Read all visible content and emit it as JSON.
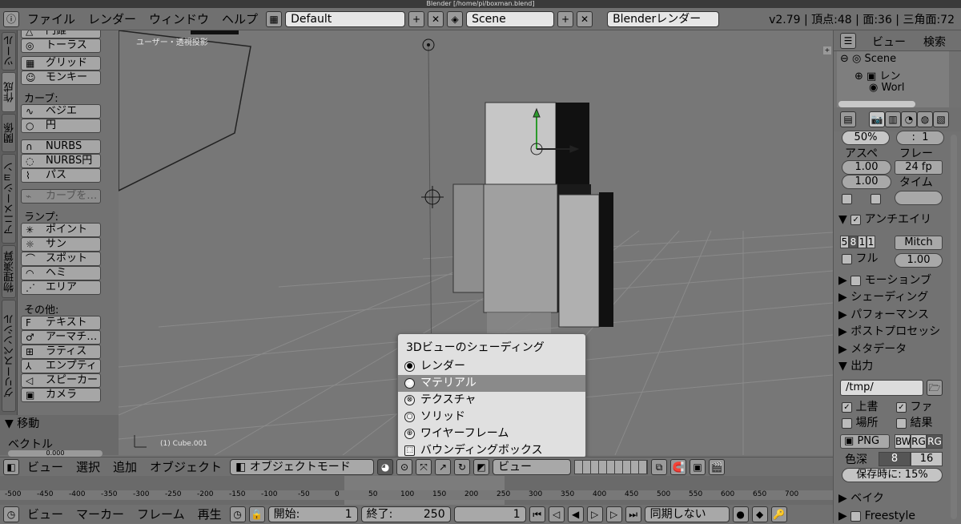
{
  "window_title": "Blender [/home/pi/boxman.blend]",
  "topbar": {
    "menus": [
      "ファイル",
      "レンダー",
      "ウィンドウ",
      "ヘルプ"
    ],
    "layout": "Default",
    "scene": "Scene",
    "engine": "Blenderレンダー",
    "stats": "v2.79 | 頂点:48 | 面:36 | 三角面:72"
  },
  "left_tabs": [
    "ツール",
    "作成",
    "関係",
    "アニメーション",
    "物理演算",
    "グリースペンシル"
  ],
  "tools": {
    "items_top": [
      "円錐",
      "トーラス",
      "グリッド",
      "モンキー"
    ],
    "curve_header": "カーブ:",
    "curve_items": [
      "ベジエ",
      "円",
      "NURBSカ…",
      "NURBS円",
      "パス",
      "カーブを…"
    ],
    "lamp_header": "ランプ:",
    "lamp_items": [
      "ポイント",
      "サン",
      "スポット",
      "ヘミ",
      "エリア"
    ],
    "other_header": "その他:",
    "other_items": [
      "テキスト",
      "アーマチ…",
      "ラティス",
      "エンプティ",
      "スピーカー",
      "カメラ"
    ]
  },
  "operator": {
    "header": "移動",
    "field": "ベクトル",
    "value": "0.000"
  },
  "viewport": {
    "label": "ユーザー・透視投影",
    "object_label": "(1) Cube.001"
  },
  "popup": {
    "title": "3Dビューのシェーディング",
    "items": [
      "レンダー",
      "マテリアル",
      "テクスチャ",
      "ソリッド",
      "ワイヤーフレーム",
      "バウンディングボックス"
    ],
    "selected_index": 1
  },
  "outliner": {
    "view": "ビュー",
    "search": "検索",
    "tree": [
      "Scene",
      "レン",
      "Worl"
    ]
  },
  "properties": {
    "percent": "50%",
    "ratio_sep": ":",
    "ratio_val": "1",
    "aspect_label": "アスペ",
    "frame_label": "フレー",
    "aspect_x": "1.00",
    "aspect_y": "1.00",
    "fps": "24 fp",
    "time_label": "タイム",
    "antialias": "アンチエイリ",
    "aa_values": [
      "5",
      "8",
      "1",
      "1"
    ],
    "filter": "Mitch",
    "full": "フル",
    "full_value": "1.00",
    "sections": [
      "モーションブ",
      "シェーディング",
      "パフォーマンス",
      "ポストプロセッシ",
      "メタデータ",
      "出力"
    ],
    "output_path": "/tmp/",
    "overwrite": "上書",
    "file_ext": "ファ",
    "placeholders": "場所",
    "results": "結果",
    "format": "PNG",
    "color_modes": [
      "BW",
      "RG",
      "RG"
    ],
    "color_depth_label": "色深",
    "color_depth": [
      "8",
      "16"
    ],
    "compression": "保存時に: 15%",
    "bake": "ベイク",
    "freestyle": "Freestyle"
  },
  "bottombar": {
    "menus": [
      "ビュー",
      "選択",
      "追加",
      "オブジェクト"
    ],
    "mode": "オブジェクトモード",
    "view": "ビュー"
  },
  "timeline": {
    "ticks": [
      "-500",
      "-450",
      "-400",
      "-350",
      "-300",
      "-250",
      "-200",
      "-150",
      "-100",
      "-50",
      "0",
      "50",
      "100",
      "150",
      "200",
      "250",
      "300",
      "350",
      "400",
      "450",
      "500",
      "550",
      "600",
      "650",
      "700"
    ],
    "menus": [
      "ビュー",
      "マーカー",
      "フレーム",
      "再生"
    ],
    "start_label": "開始:",
    "start": "1",
    "end_label": "終了:",
    "end": "250",
    "current": "1",
    "sync": "同期しない"
  }
}
